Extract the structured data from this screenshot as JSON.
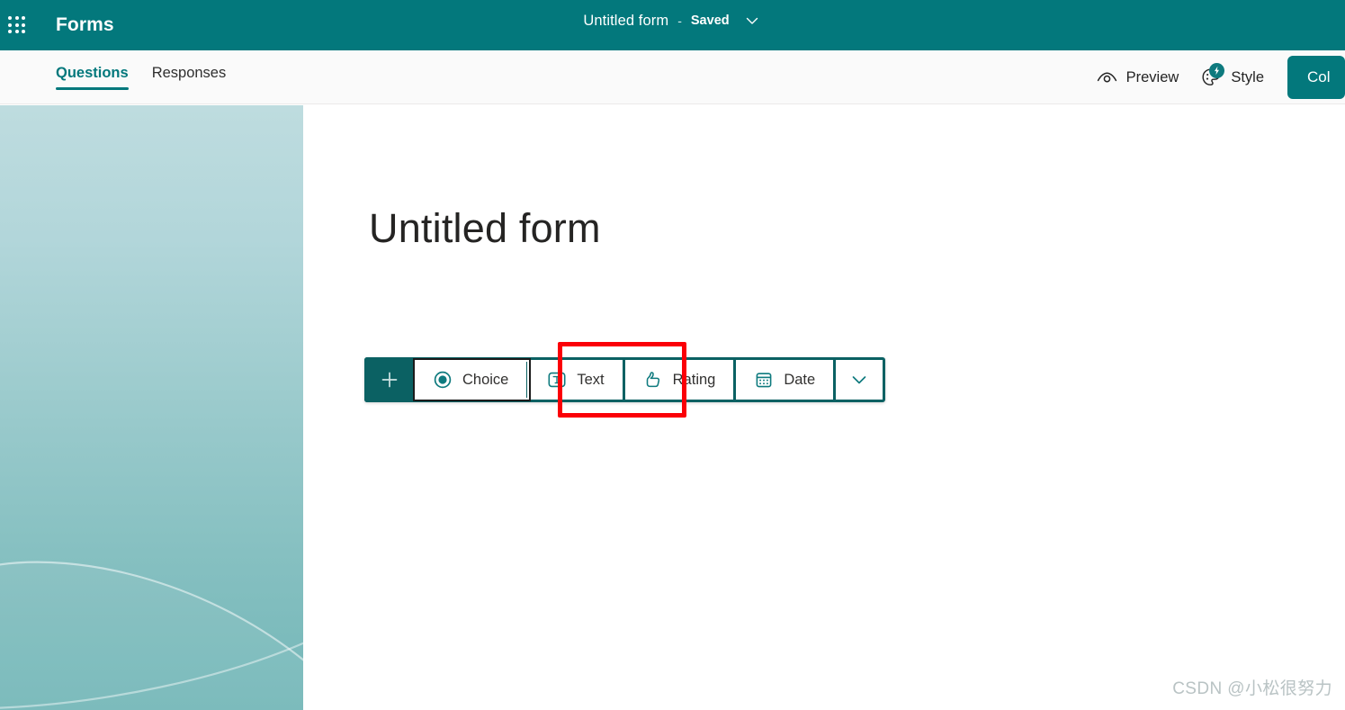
{
  "suite_header": {
    "waffle_icon": "app-launcher-waffle-icon",
    "brand": "Forms",
    "document_title": "Untitled form",
    "separator": "-",
    "save_status": "Saved",
    "chevron_icon": "chevron-down-icon"
  },
  "command_bar": {
    "tabs": [
      {
        "label": "Questions",
        "active": true
      },
      {
        "label": "Responses",
        "active": false
      }
    ],
    "actions": [
      {
        "label": "Preview",
        "icon": "eye-preview-icon"
      },
      {
        "label": "Style",
        "icon": "palette-style-icon",
        "badge_icon": "copilot-sparkle-bolt-icon"
      }
    ],
    "collect_button": {
      "label": "Col",
      "full_label": "Col"
    }
  },
  "form": {
    "title": "Untitled form",
    "add_toolbar": {
      "add_icon": "plus-icon",
      "question_types": [
        {
          "label": "Choice",
          "icon": "radio-button-icon",
          "focused": true
        },
        {
          "label": "Text",
          "icon": "text-box-T-icon",
          "focused": false
        },
        {
          "label": "Rating",
          "icon": "thumbs-up-icon",
          "focused": false
        },
        {
          "label": "Date",
          "icon": "calendar-icon",
          "focused": false
        }
      ],
      "more_icon": "chevron-down-icon"
    }
  },
  "annotation": {
    "target": "Text",
    "color": "#fb0007"
  },
  "watermark": {
    "text": "CSDN @小松很努力"
  },
  "colors": {
    "header_teal": "#03787c",
    "toolbar_dark_teal": "#0b6163",
    "accent_teal": "#0e7a7e",
    "icon_teal": "#0e7a7e",
    "command_bar_bg": "#fafafa",
    "theme_strip_top": "#bedcdf",
    "theme_strip_bottom": "#74b7b8",
    "annotation_red": "#fb0007",
    "watermark_gray": "#b9c3c4"
  }
}
